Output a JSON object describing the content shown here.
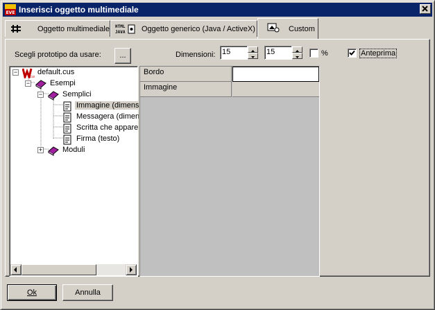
{
  "window": {
    "title": "Inserisci oggetto multimediale",
    "close_label": "×"
  },
  "tabs": [
    {
      "label": "Oggetto multimediale",
      "icon": "toolbar-icon",
      "active": false
    },
    {
      "label": "Oggetto generico (Java / ActiveX)",
      "icon": "html-java-icon",
      "active": false
    },
    {
      "label": "Custom",
      "icon": "picture-icon",
      "active": true
    }
  ],
  "prototype": {
    "label": "Scegli prototipo da usare:",
    "browse_label": "..."
  },
  "dimensions": {
    "label": "Dimensioni:",
    "width": "15",
    "height": "15",
    "percent_label": "%",
    "percent_checked": false
  },
  "preview": {
    "label": "Anteprima",
    "checked": true
  },
  "tree": {
    "root": "default.cus",
    "group": "Esempi",
    "subgroup": "Semplici",
    "items": [
      "Immagine (dimensioni",
      "Messagera (dimensioni",
      "Scritta che appare",
      "Firma (testo)"
    ],
    "modules": "Moduli",
    "expand_label": "+",
    "collapse_label": "−"
  },
  "properties": [
    {
      "name": "Bordo",
      "value": ""
    },
    {
      "name": "Immagine",
      "value": ""
    }
  ],
  "buttons": {
    "ok": "Ok",
    "cancel": "Annulla"
  },
  "colors": {
    "titlebar": "#0a246a",
    "face": "#d4d0c8"
  }
}
